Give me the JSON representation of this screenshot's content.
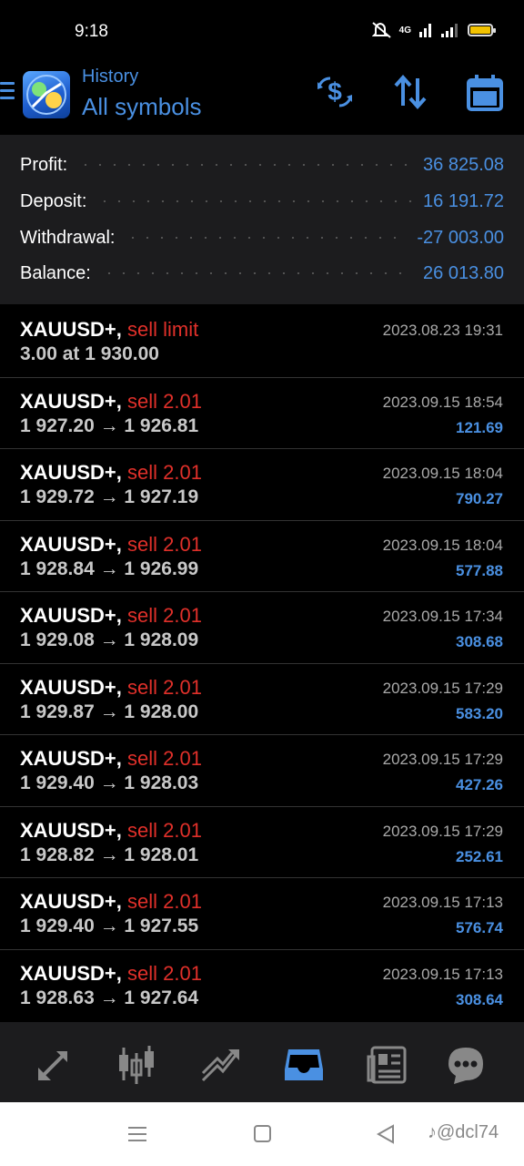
{
  "status": {
    "time": "9:18",
    "network": "4G"
  },
  "header": {
    "title": "History",
    "subtitle": "All symbols"
  },
  "summary": [
    {
      "label": "Profit:",
      "value": "36 825.08"
    },
    {
      "label": "Deposit:",
      "value": "16 191.72"
    },
    {
      "label": "Withdrawal:",
      "value": "-27 003.00"
    },
    {
      "label": "Balance:",
      "value": "26 013.80"
    }
  ],
  "trades": [
    {
      "symbol": "XAUUSD+,",
      "side": "sell limit",
      "details": "3.00 at 1 930.00",
      "time": "2023.08.23 19:31",
      "profit": ""
    },
    {
      "symbol": "XAUUSD+,",
      "side": "sell 2.01",
      "details": "1 927.20 → 1 926.81",
      "time": "2023.09.15 18:54",
      "profit": "121.69"
    },
    {
      "symbol": "XAUUSD+,",
      "side": "sell 2.01",
      "details": "1 929.72 → 1 927.19",
      "time": "2023.09.15 18:04",
      "profit": "790.27"
    },
    {
      "symbol": "XAUUSD+,",
      "side": "sell 2.01",
      "details": "1 928.84 → 1 926.99",
      "time": "2023.09.15 18:04",
      "profit": "577.88"
    },
    {
      "symbol": "XAUUSD+,",
      "side": "sell 2.01",
      "details": "1 929.08 → 1 928.09",
      "time": "2023.09.15 17:34",
      "profit": "308.68"
    },
    {
      "symbol": "XAUUSD+,",
      "side": "sell 2.01",
      "details": "1 929.87 → 1 928.00",
      "time": "2023.09.15 17:29",
      "profit": "583.20"
    },
    {
      "symbol": "XAUUSD+,",
      "side": "sell 2.01",
      "details": "1 929.40 → 1 928.03",
      "time": "2023.09.15 17:29",
      "profit": "427.26"
    },
    {
      "symbol": "XAUUSD+,",
      "side": "sell 2.01",
      "details": "1 928.82 → 1 928.01",
      "time": "2023.09.15 17:29",
      "profit": "252.61"
    },
    {
      "symbol": "XAUUSD+,",
      "side": "sell 2.01",
      "details": "1 929.40 → 1 927.55",
      "time": "2023.09.15 17:13",
      "profit": "576.74"
    },
    {
      "symbol": "XAUUSD+,",
      "side": "sell 2.01",
      "details": "1 928.63 → 1 927.64",
      "time": "2023.09.15 17:13",
      "profit": "308.64"
    }
  ],
  "bottom_nav": [
    "quotes-icon",
    "chart-icon",
    "trade-icon",
    "history-icon",
    "news-icon",
    "chat-icon"
  ],
  "watermark": "♪@dcl74",
  "colors": {
    "accent": "#4a90e2",
    "sell": "#e0302a",
    "summary_bg": "#1c1c1e"
  }
}
